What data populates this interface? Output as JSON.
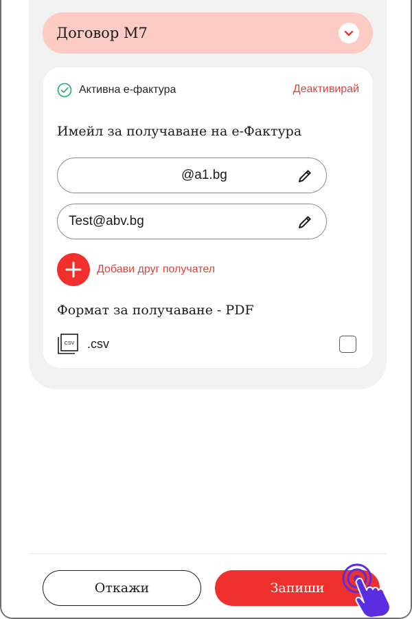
{
  "contract": {
    "title": "Договор М7"
  },
  "einvoice": {
    "status_text": "Активна е-фактура",
    "deactivate_label": "Деактивирай",
    "email_heading": "Имейл за получаване на е-Фактура",
    "emails": [
      "@a1.bg",
      "Test@abv.bg"
    ],
    "add_recipient_label": "Добави друг получател",
    "format_heading": "Формат за получаване - PDF",
    "format_option_label": ".csv",
    "format_icon_text": "CSV",
    "format_option_checked": false
  },
  "footer": {
    "cancel_label": "Откажи",
    "save_label": "Запиши"
  },
  "colors": {
    "accent": "#f0302c",
    "accent_soft": "#fbcbc4",
    "success": "#2bb673",
    "cursor": "#5a2ee0"
  }
}
